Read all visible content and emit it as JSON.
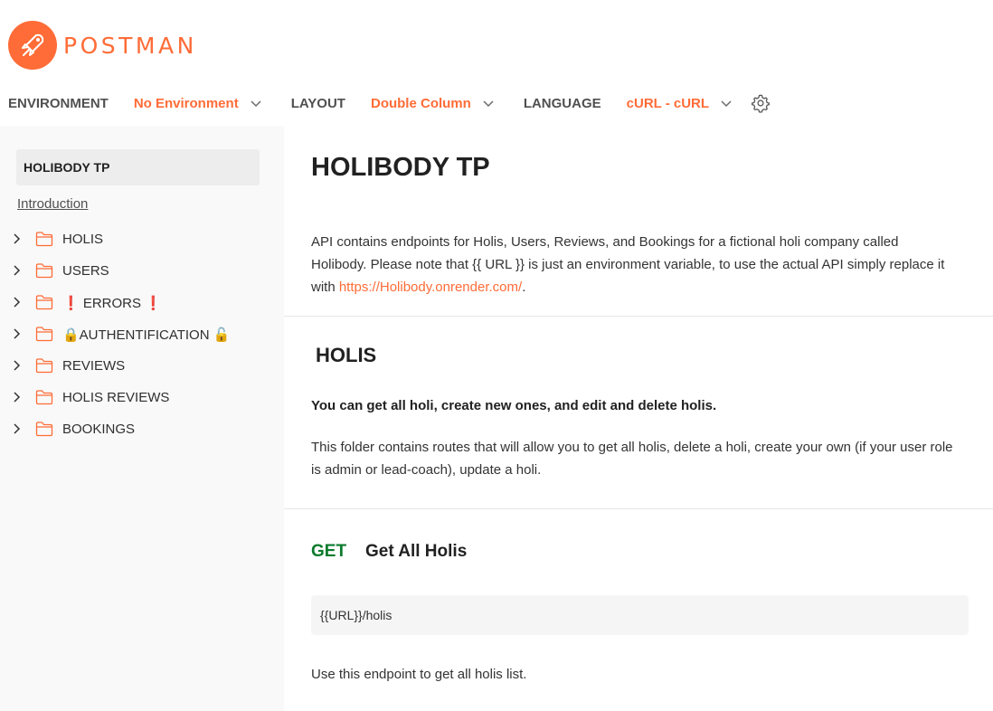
{
  "brand": {
    "name": "POSTMAN",
    "color": "#FF6C37"
  },
  "toolbar": {
    "environment_label": "ENVIRONMENT",
    "environment_value": "No Environment",
    "layout_label": "LAYOUT",
    "layout_value": "Double Column",
    "language_label": "LANGUAGE",
    "language_value": "cURL - cURL"
  },
  "sidebar": {
    "title": "HOLIBODY TP",
    "intro_link": "Introduction",
    "items": [
      {
        "label": "HOLIS",
        "icon": "folder-icon"
      },
      {
        "label": "USERS",
        "icon": "folder-icon"
      },
      {
        "label": "❗ ERRORS ❗",
        "icon": "folder-icon"
      },
      {
        "label": "🔒AUTHENTIFICATION 🔓",
        "icon": "folder-icon"
      },
      {
        "label": "REVIEWS",
        "icon": "folder-icon"
      },
      {
        "label": "HOLIS REVIEWS",
        "icon": "folder-icon"
      },
      {
        "label": "BOOKINGS",
        "icon": "folder-icon"
      }
    ]
  },
  "main": {
    "title": "HOLIBODY TP",
    "intro_part1": "API contains endpoints for Holis, Users, Reviews, and Bookings for a fictional holi company called Holibody. Please note that {{ URL }} is just an environment variable, to use the actual API simply replace it with ",
    "intro_link": "https://Holibody.onrender.com/",
    "intro_part2": ".",
    "folder": {
      "title": "HOLIS",
      "summary": "You can get all holi, create new ones, and edit and delete holis.",
      "description": "This folder contains routes that will allow you to get all holis, delete a holi, create your own (if your user role is admin or lead-coach), update a holi."
    },
    "request": {
      "method": "GET",
      "name": "Get All Holis",
      "url": "{{URL}}/holis",
      "description": "Use this endpoint to get all holis list."
    }
  }
}
